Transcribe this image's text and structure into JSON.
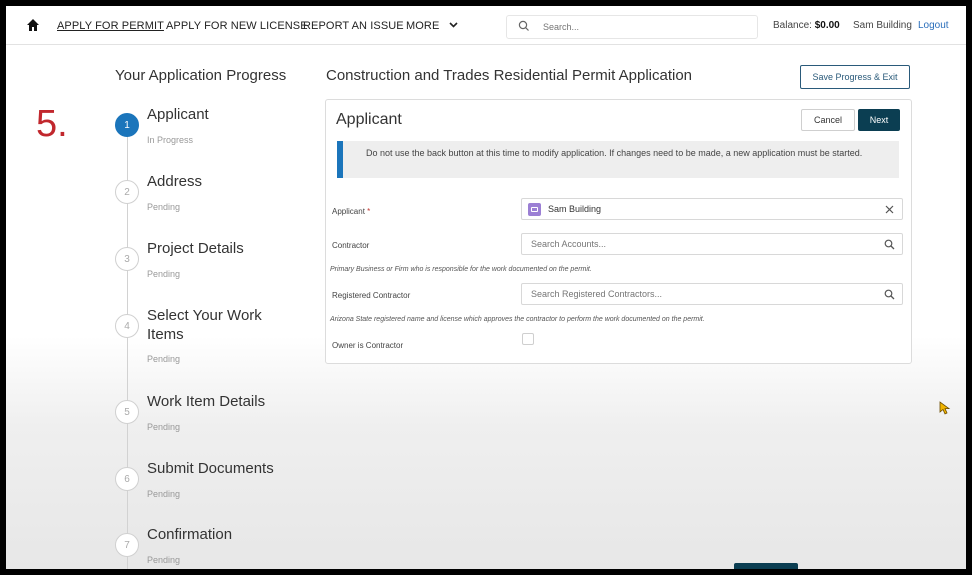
{
  "nav": {
    "links": [
      "APPLY FOR PERMIT",
      "APPLY FOR NEW LICENSE",
      "REPORT AN ISSUE",
      "MORE"
    ],
    "search_placeholder": "Search...",
    "balance_label": "Balance:",
    "balance_value": "$0.00",
    "user_name": "Sam Building",
    "logout": "Logout"
  },
  "step_marker": "5.",
  "progress": {
    "title": "Your Application Progress",
    "steps": [
      {
        "number": "1",
        "title": "Applicant",
        "status": "In Progress",
        "active": true
      },
      {
        "number": "2",
        "title": "Address",
        "status": "Pending"
      },
      {
        "number": "3",
        "title": "Project Details",
        "status": "Pending"
      },
      {
        "number": "4",
        "title": "Select Your Work Items",
        "status": "Pending"
      },
      {
        "number": "5",
        "title": "Work Item Details",
        "status": "Pending"
      },
      {
        "number": "6",
        "title": "Submit Documents",
        "status": "Pending"
      },
      {
        "number": "7",
        "title": "Confirmation",
        "status": "Pending"
      }
    ]
  },
  "main": {
    "title": "Construction and Trades Residential Permit Application",
    "save_exit": "Save Progress & Exit"
  },
  "card": {
    "title": "Applicant",
    "cancel": "Cancel",
    "next": "Next",
    "notice": "Do not use the back button at this time to modify application. If changes need to be made, a new application must be started.",
    "applicant_label": "Applicant",
    "applicant_required": "*",
    "applicant_value": "Sam Building",
    "contractor_label": "Contractor",
    "contractor_placeholder": "Search Accounts...",
    "contractor_help": "Primary Business or Firm who is responsible for the work documented on the permit.",
    "registered_label": "Registered Contractor",
    "registered_placeholder": "Search Registered Contractors...",
    "registered_help": "Arizona State registered name and license which approves the contractor to perform the work documented on the permit.",
    "owner_label": "Owner is Contractor",
    "owner_checked": false
  },
  "colors": {
    "accent": "#1b75bb",
    "primary_button": "#0b3e52",
    "marker": "#c1272d",
    "logout": "#2a6ebb"
  }
}
